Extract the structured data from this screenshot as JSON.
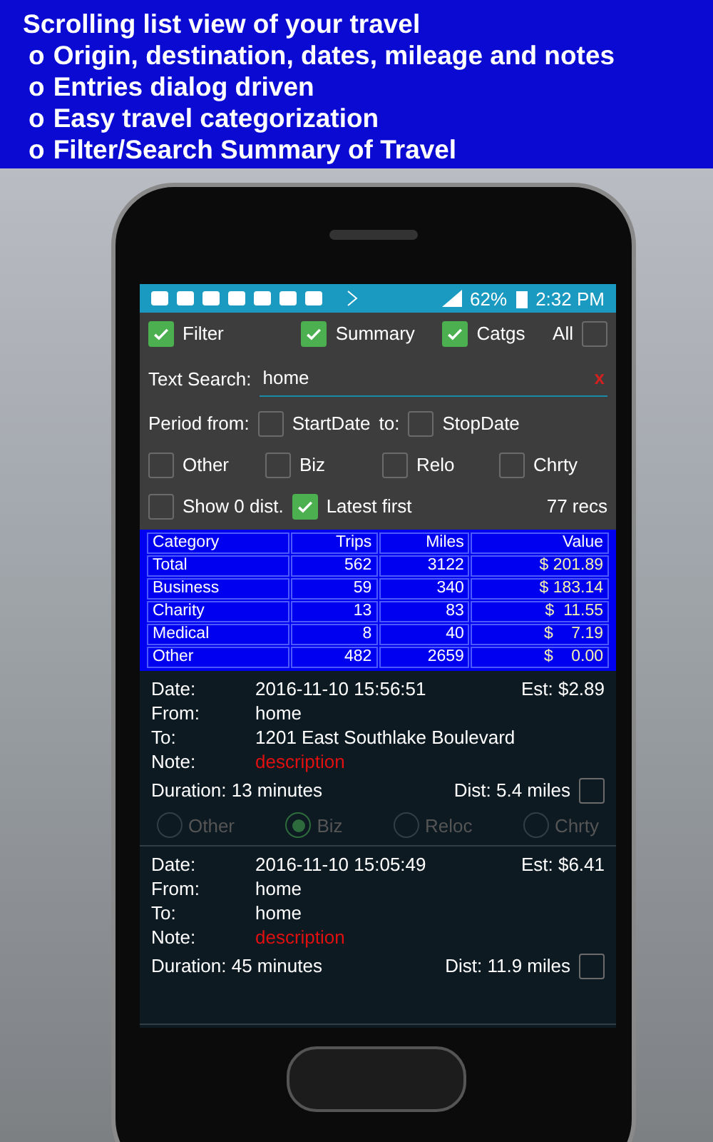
{
  "banner": {
    "title": "Scrolling list view of your travel",
    "bullets": [
      {
        "marker": "o",
        "text": "Origin, destination, dates, mileage and notes"
      },
      {
        "marker": "o",
        "text": "Entries dialog driven"
      },
      {
        "marker": "o",
        "text": "Easy travel categorization"
      },
      {
        "marker": "o",
        "text": "Filter/Search Summary of Travel"
      }
    ]
  },
  "status_bar": {
    "battery": "62%",
    "time": "2:32 PM"
  },
  "toggles": [
    {
      "kind": "box_left",
      "label": "Filter",
      "checked": true
    },
    {
      "kind": "box_left",
      "label": "Summary",
      "checked": true
    },
    {
      "kind": "box_left",
      "label": "Catgs",
      "checked": true
    },
    {
      "kind": "box_right",
      "label": "All",
      "checked": false
    }
  ],
  "search": {
    "label": "Text Search:",
    "value": "home",
    "clear": "x"
  },
  "period": {
    "label": "Period from:",
    "start": {
      "label": "StartDate",
      "checked": false
    },
    "to": "to:",
    "stop": {
      "label": "StopDate",
      "checked": false
    }
  },
  "categories": [
    {
      "label": "Other",
      "checked": false
    },
    {
      "label": "Biz",
      "checked": false
    },
    {
      "label": "Relo",
      "checked": false
    },
    {
      "label": "Chrty",
      "checked": false
    }
  ],
  "options": [
    {
      "label": "Show 0 dist.",
      "checked": false
    },
    {
      "label": "Latest first",
      "checked": true
    }
  ],
  "record_count": "77 recs",
  "table": {
    "columns": [
      "Category",
      "Trips",
      "Miles",
      "Value"
    ],
    "rows": [
      [
        "Total",
        "562",
        "3122",
        "$ 201.89"
      ],
      [
        "Business",
        "59",
        "340",
        "$ 183.14"
      ],
      [
        "Charity",
        "13",
        "83",
        "$  11.55"
      ],
      [
        "Medical",
        "8",
        "40",
        "$    7.19"
      ],
      [
        "Other",
        "482",
        "2659",
        "$    0.00"
      ]
    ]
  },
  "trips": [
    {
      "date_label": "Date:",
      "date": "2016-11-10 15:56:51",
      "est": "Est: $2.89",
      "from_label": "From:",
      "from": "home",
      "to_label": "To:",
      "to": "1201 East Southlake Boulevard",
      "note_label": "Note:",
      "note": "description",
      "duration": "Duration: 13 minutes",
      "dist": "Dist: 5.4 miles",
      "dist_checked": false,
      "categories": [
        {
          "label": "Other",
          "selected": false
        },
        {
          "label": "Biz",
          "selected": true
        },
        {
          "label": "Reloc",
          "selected": false
        },
        {
          "label": "Chrty",
          "selected": false
        }
      ]
    },
    {
      "date_label": "Date:",
      "date": "2016-11-10 15:05:49",
      "est": "Est: $6.41",
      "from_label": "From:",
      "from": "home",
      "to_label": "To:",
      "to": "home",
      "note_label": "Note:",
      "note": "description",
      "duration": "Duration: 45 minutes",
      "dist": "Dist: 11.9 miles",
      "dist_checked": false
    }
  ]
}
